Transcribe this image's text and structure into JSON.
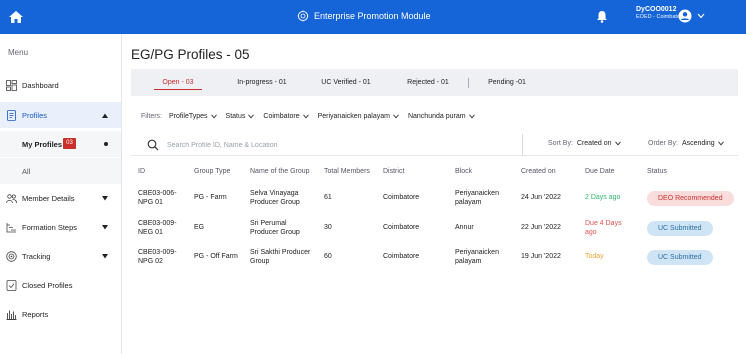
{
  "topbar": {
    "title": "Enterprise Promotion Module",
    "user_id": "DyCOO0012",
    "user_location": "EOED - Coimbatore",
    "bg_color": "#1565d8",
    "icons": [
      "home-icon",
      "logo-icon",
      "bell-icon",
      "account-icon",
      "chevron-down-icon"
    ]
  },
  "sidebar": {
    "title": "Menu",
    "items": [
      {
        "label": "Dashboard",
        "icon": "dashboard-icon"
      },
      {
        "label": "Profiles",
        "icon": "profile-doc-icon"
      },
      {
        "label": "Member Details",
        "icon": "members-icon"
      },
      {
        "label": "Formation Steps",
        "icon": "steps-icon"
      },
      {
        "label": "Tracking",
        "icon": "tracking-icon"
      },
      {
        "label": "Closed Profiles",
        "icon": "closed-doc-icon"
      },
      {
        "label": "Reports",
        "icon": "reports-icon"
      }
    ],
    "sub_items": [
      {
        "label": "My Profiles",
        "count": "03"
      },
      {
        "label": "All"
      }
    ]
  },
  "main": {
    "title": "EG/PG Profiles - 05",
    "tabs": [
      {
        "label": "Open - 03"
      },
      {
        "label": "In-progress - 01"
      },
      {
        "label": "UC Verified - 01"
      },
      {
        "label": "Rejected - 01"
      },
      {
        "label": "Pending -01"
      }
    ],
    "filters": {
      "label": "Filters:",
      "items": [
        "ProfileTypes",
        "Status",
        "Coimbatore",
        "Periyanaicken palayam",
        "Nanchunda puram"
      ]
    },
    "search_placeholder": "Search Profile ID, Name & Location",
    "sort": {
      "label": "Sort By:",
      "value": "Created on"
    },
    "order": {
      "label": "Order By:",
      "value": "Ascending"
    },
    "table": {
      "columns": [
        "ID",
        "Group Type",
        "Name of the Group",
        "Total Members",
        "District",
        "Block",
        "Created on",
        "Due Date",
        "Status"
      ],
      "rows": [
        {
          "id": "CBE03-006-NPG 01",
          "group_type": "PG - Farm",
          "name": "Selva Vinayaga Producer Group",
          "members": "61",
          "district": "Coimbatore",
          "block": "Periyanaicken palayam",
          "created": "24 Jun '2022",
          "due": "2 Days ago",
          "status": "DEO Recommended"
        },
        {
          "id": "CBE03-009-NEG 01",
          "group_type": "EG",
          "name": "Sri Perumal Producer Group",
          "members": "30",
          "district": "Coimbatore",
          "block": "Annur",
          "created": "22 Jun '2022",
          "due": "Due 4 Days ago",
          "status": "UC Submitted"
        },
        {
          "id": "CBE03-009-NPG 02",
          "group_type": "PG - Off Farm",
          "name": "Sri Sakthi Producer Group",
          "members": "60",
          "district": "Coimbatore",
          "block": "Periyanaicken palayam",
          "created": "19 Jun '2022",
          "due": "Today",
          "status": "UC Submitted"
        }
      ],
      "due_colors": [
        "#2fb36a",
        "#e0524c",
        "#f0a63a"
      ]
    }
  }
}
